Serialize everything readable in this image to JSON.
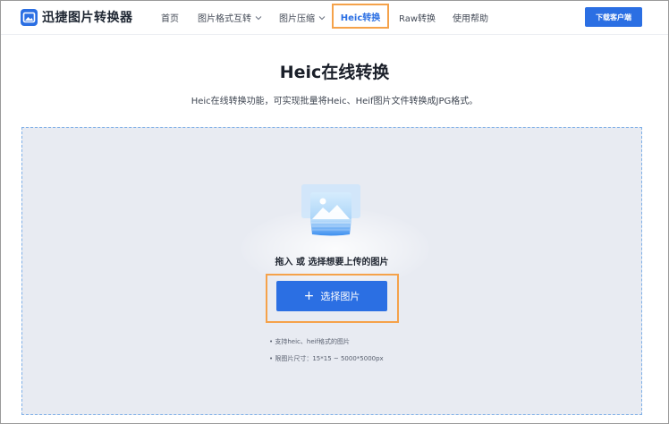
{
  "header": {
    "logo_text": "迅捷图片转换器",
    "nav": {
      "home": "首页",
      "format_convert": "图片格式互转",
      "compress": "图片压缩",
      "heic": "Heic转换",
      "raw": "Raw转换",
      "help": "使用帮助"
    },
    "download_label": "下载客户端"
  },
  "main": {
    "title": "Heic在线转换",
    "subtitle": "Heic在线转换功能，可实现批量将Heic、Heif图片文件转换成JPG格式。"
  },
  "upload": {
    "hint": "拖入 或 选择想要上传的图片",
    "button_icon": "+",
    "button_label": "选择图片",
    "requirements": [
      "• 支持heic、heif格式的图片",
      "• 限图片尺寸：15*15 ~ 5000*5000px"
    ]
  },
  "colors": {
    "accent": "#2b6fe3",
    "highlight": "#f5a24a",
    "dropzone_bg": "#e8ebf2"
  },
  "icons": [
    "logo-icon",
    "chevron-down-icon",
    "image-upload-illustration",
    "plus-icon"
  ]
}
